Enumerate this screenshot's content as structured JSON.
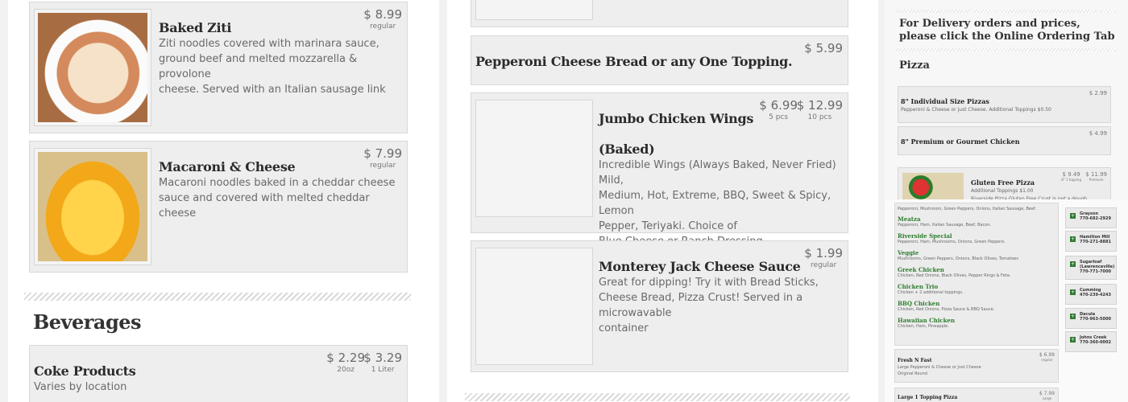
{
  "left": {
    "items": [
      {
        "name": "Baked Ziti",
        "desc": [
          "Ziti noodles covered with marinara sauce,",
          "ground beef and melted mozzarella & provolone",
          "cheese. Served with an Italian sausage link"
        ],
        "price": "$ 8.99",
        "price_label": "regular",
        "image": "baked-ziti-photo"
      },
      {
        "name": "Macaroni & Cheese",
        "desc": [
          "Macaroni noodles baked in a cheddar cheese",
          "sauce and covered with melted cheddar cheese"
        ],
        "price": "$ 7.99",
        "price_label": "regular",
        "image": "macaroni-photo"
      }
    ],
    "beverages": {
      "title": "Beverages",
      "item": {
        "name": "Coke Products",
        "desc": "Varies by location",
        "prices": [
          {
            "amt": "$ 2.29",
            "lbl": "20oz"
          },
          {
            "amt": "$ 3.29",
            "lbl": "1 Liter"
          }
        ]
      }
    }
  },
  "middle": {
    "pepperoni": {
      "name": "Pepperoni Cheese Bread or any One Topping.",
      "price": "$ 5.99"
    },
    "wings": {
      "name1": "Jumbo Chicken Wings",
      "name2": "(Baked)",
      "desc": [
        "Incredible Wings (Always Baked, Never Fried) Mild,",
        "Medium, Hot, Extreme, BBQ, Sweet & Spicy, Lemon",
        "Pepper, Teriyaki. Choice of",
        "Blue Cheese or Ranch Dressing."
      ],
      "prices": [
        {
          "amt": "$ 6.99",
          "lbl": "5 pcs"
        },
        {
          "amt": "$ 12.99",
          "lbl": "10 pcs"
        }
      ]
    },
    "sauce": {
      "name": "Monterey Jack Cheese Sauce",
      "desc": [
        "Great for dipping! Try it with Bread Sticks,",
        "Cheese Bread, Pizza Crust! Served in a microwavable",
        "container"
      ],
      "price": "$ 1.99",
      "price_label": "regular"
    }
  },
  "right": {
    "heading": "For Delivery orders and prices, please click the Online Ordering Tab",
    "section": "Pizza",
    "items": [
      {
        "name": "8\" Individual Size Pizzas",
        "desc": "Pepperoni & Cheese or just Cheese. Additional Toppings $0.50",
        "price": "$ 2.99"
      },
      {
        "name": "8\" Premium or Gourmet Chicken",
        "desc": "",
        "price": "$ 4.99"
      },
      {
        "name": "Gluten Free Pizza",
        "desc": "Additional Toppings $1.00",
        "desc2": "Riverside Pizza Gluten Free Crust is not a dough",
        "prices": [
          {
            "amt": "$ 9.49",
            "lbl": "8\" 1 topping"
          },
          {
            "amt": "$ 11.99",
            "lbl": "Premium"
          }
        ]
      }
    ],
    "specialties": [
      {
        "name": "",
        "desc": "Pepperoni, Mushroom, Green Peppers, Onions, Italian Sausage, Beef."
      },
      {
        "name": "Meatza",
        "desc": "Pepperoni, Ham, Italian Sausage, Beef, Bacon."
      },
      {
        "name": "Riverside Special",
        "desc": "Pepperoni, Ham, Mushrooms, Onions, Green Peppers."
      },
      {
        "name": "Veggie",
        "desc": "Mushrooms, Green Peppers, Onions, Black Olives, Tomatoes"
      },
      {
        "name": "Greek Chicken",
        "desc": "Chicken, Red Onions, Black Olives, Pepper Rings & Feta."
      },
      {
        "name": "Chicken Trio",
        "desc": "Chicken + 2 additional toppings."
      },
      {
        "name": "BBQ Chicken",
        "desc": "Chicken, Red Onions, Pizza Sauce & BBQ Sauce."
      },
      {
        "name": "Hawaiian Chicken",
        "desc": "Chicken, Ham, Pineapple."
      }
    ],
    "fresh": {
      "name": "Fresh N Fast",
      "desc1": "Large Pepperoni & Cheese or Just Cheese",
      "desc2": "Original Round",
      "price": "$ 6.99",
      "lbl": "regular"
    },
    "large": {
      "name": "Large 1 Topping Pizza",
      "price": "$ 7.99",
      "lbl": "Large"
    },
    "locations": [
      {
        "name": "Grayson",
        "phone": "770-682-2929"
      },
      {
        "name": "Hamilton Mill",
        "phone": "770-271-8881"
      },
      {
        "name": "Sugarloaf (Lawrenceville)",
        "phone": "770-771-7000"
      },
      {
        "name": "Cumming",
        "phone": "470-239-4243"
      },
      {
        "name": "Dacula",
        "phone": "770-963-5000"
      },
      {
        "name": "Johns Creek",
        "phone": "770-360-0002"
      }
    ]
  }
}
